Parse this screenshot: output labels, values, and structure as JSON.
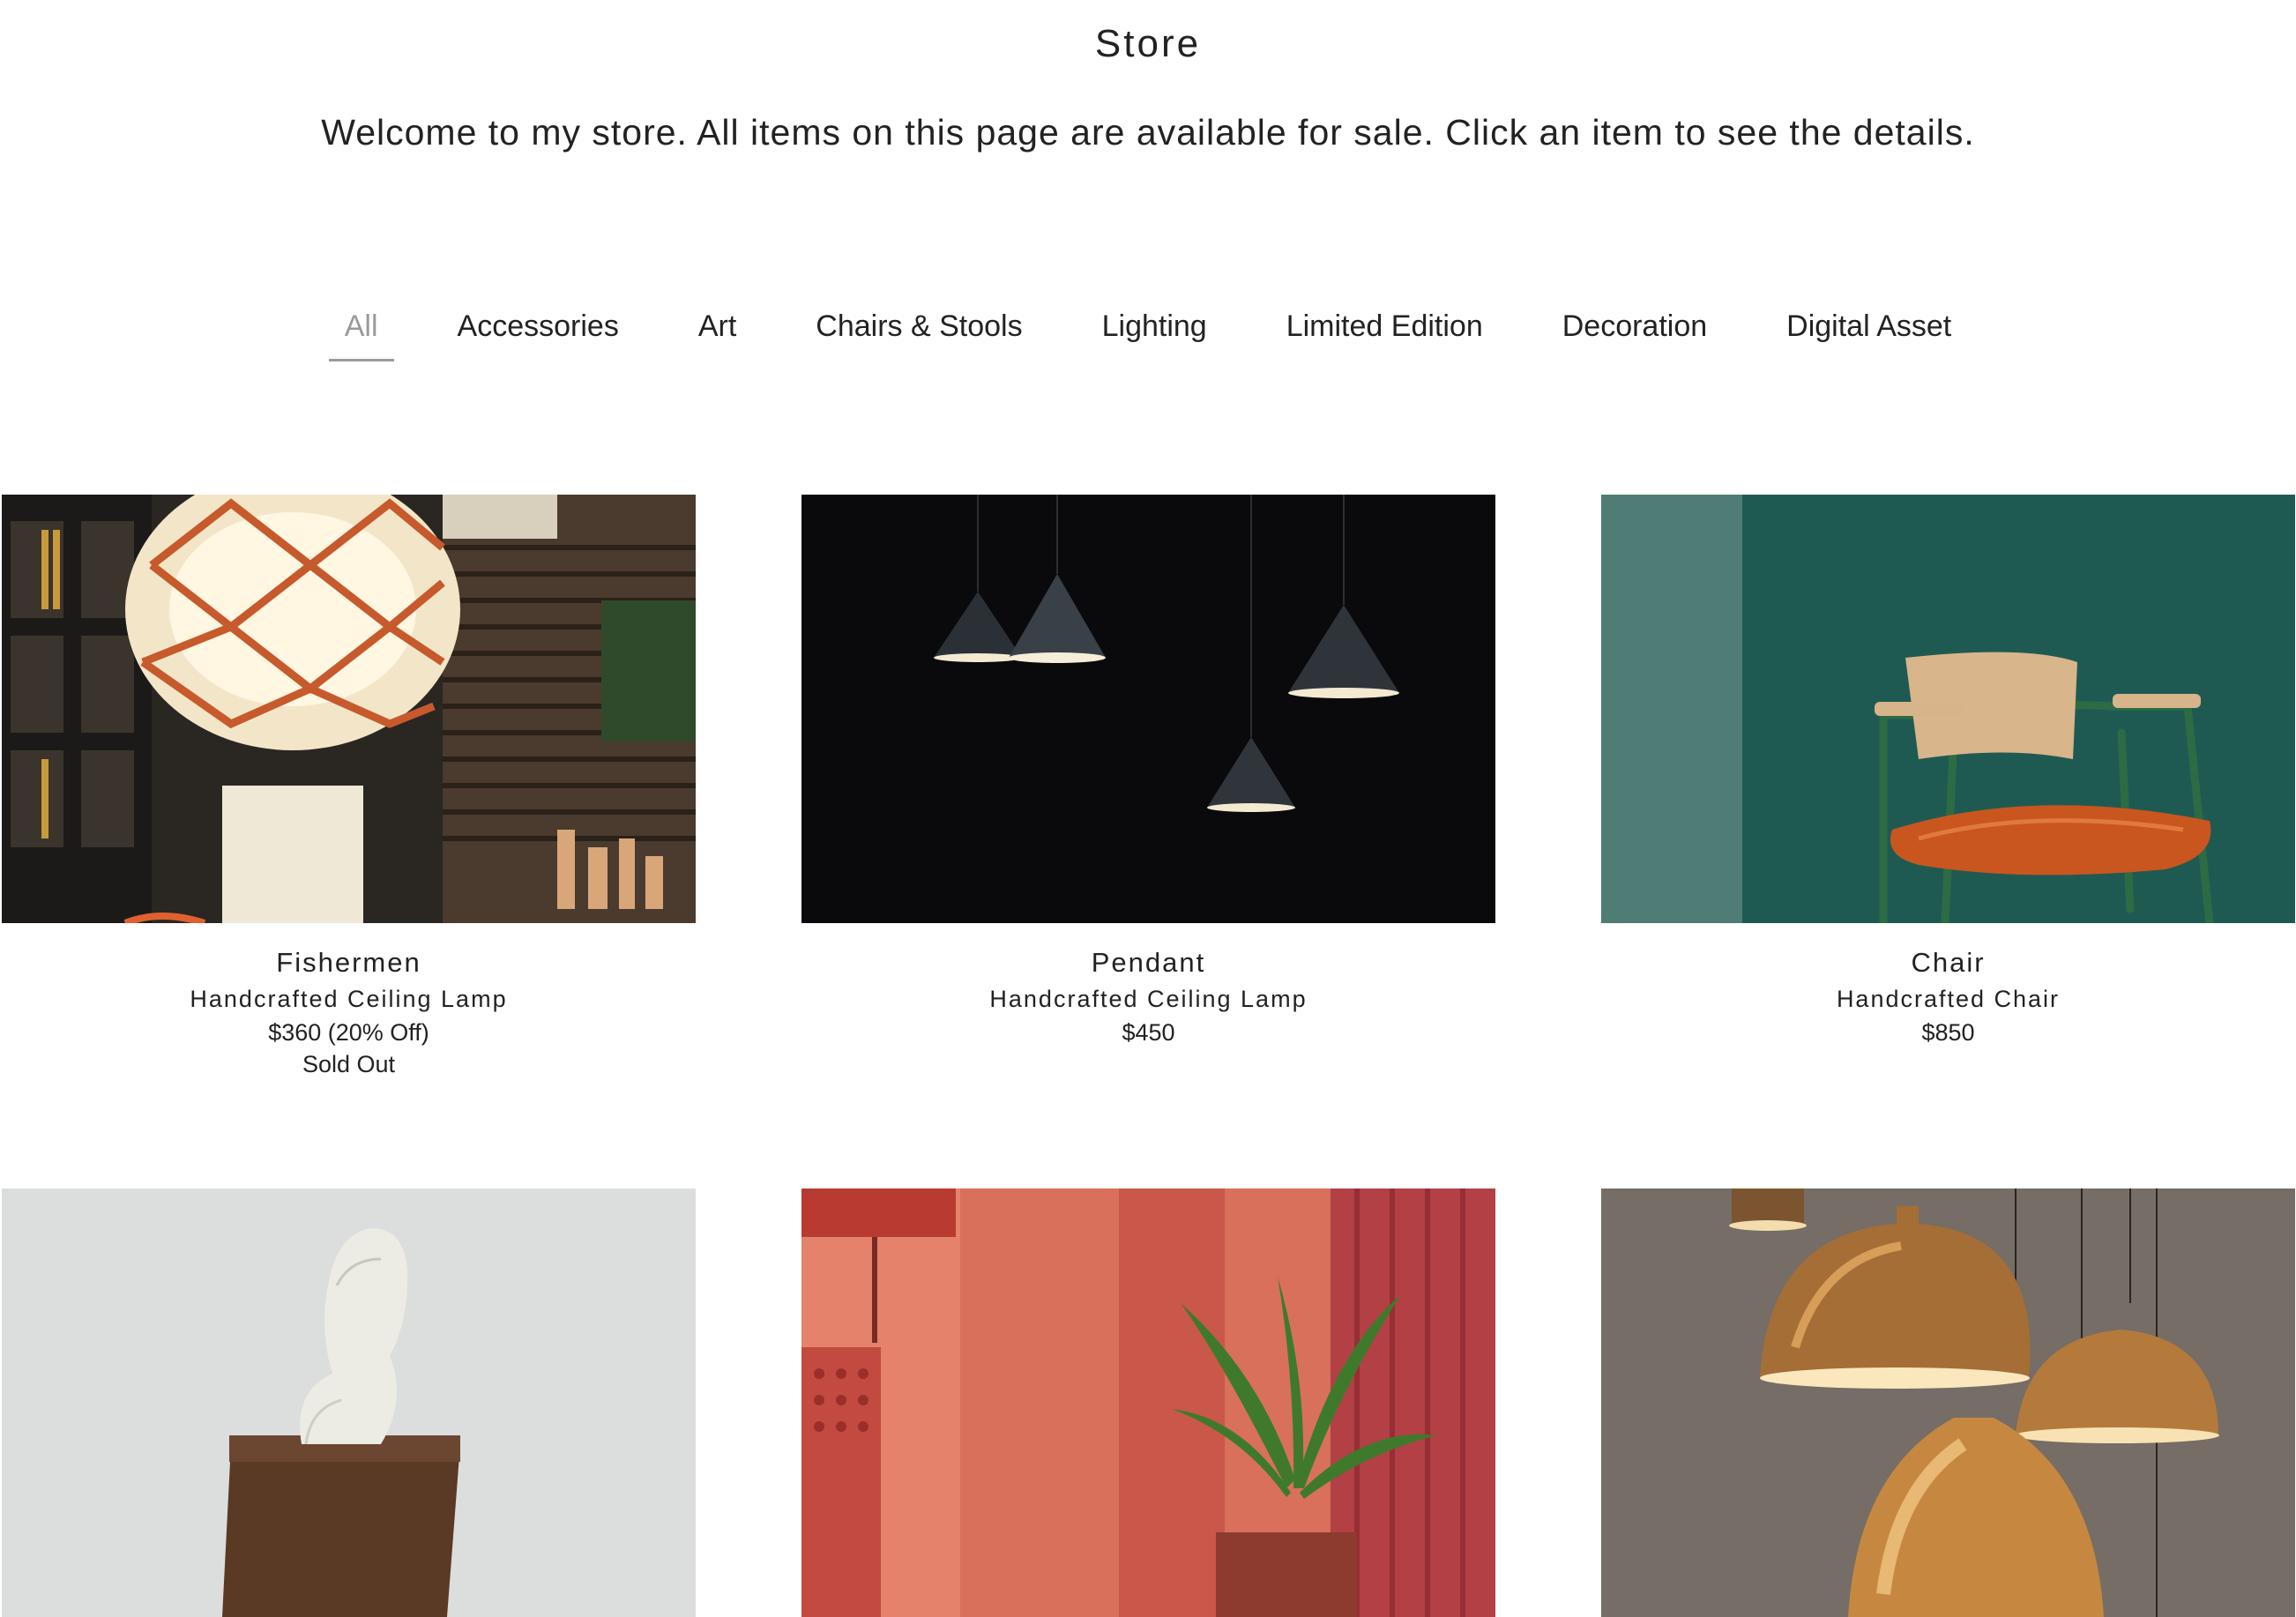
{
  "header": {
    "title": "Store",
    "intro": "Welcome to my store. All items on this page are available for sale. Click an item to see the details."
  },
  "categories": {
    "items": [
      {
        "label": "All",
        "active": true
      },
      {
        "label": "Accessories",
        "active": false
      },
      {
        "label": "Art",
        "active": false
      },
      {
        "label": "Chairs & Stools",
        "active": false
      },
      {
        "label": "Lighting",
        "active": false
      },
      {
        "label": "Limited Edition",
        "active": false
      },
      {
        "label": "Decoration",
        "active": false
      },
      {
        "label": "Digital Asset",
        "active": false
      }
    ]
  },
  "products": [
    {
      "name": "Fishermen",
      "subtitle": "Handcrafted Ceiling Lamp",
      "price": "$360 (20% Off)",
      "status": "Sold Out",
      "image": "lamp-net-photo"
    },
    {
      "name": "Pendant",
      "subtitle": "Handcrafted Ceiling Lamp",
      "price": "$450",
      "image": "cone-pendants-photo"
    },
    {
      "name": "Chair",
      "subtitle": "Handcrafted Chair",
      "price": "$850",
      "image": "green-chair-photo"
    },
    {
      "image": "sculpture-photo"
    },
    {
      "image": "red-room-plant-photo"
    },
    {
      "image": "copper-pendants-photo"
    }
  ],
  "colors": {
    "text": "#222222",
    "active_tab": "#9a9a9a",
    "background": "#ffffff"
  }
}
